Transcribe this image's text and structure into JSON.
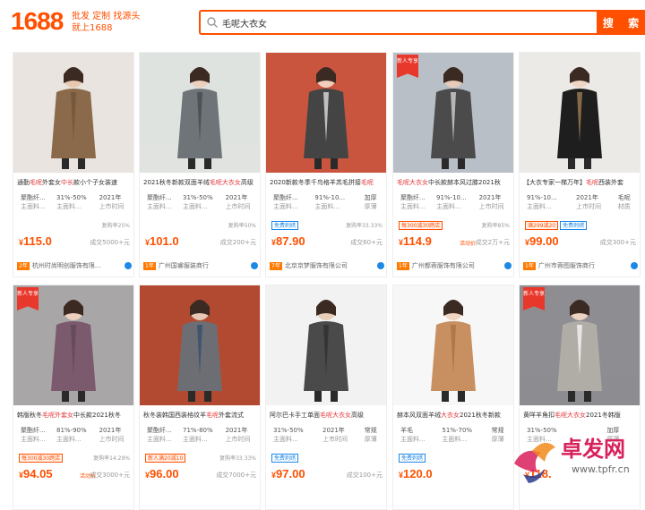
{
  "header": {
    "logo": "1688",
    "slogan_line1": "批发 定制 找源头",
    "slogan_line2": "就上1688",
    "search_value": "毛呢大衣女",
    "search_button": "搜 索"
  },
  "products": [
    {
      "title_pre": "通勤",
      "title_hl": "毛呢",
      "title_mid": "外套女",
      "title_hl2": "中长",
      "title_post": "款小个子女装速",
      "attrs": [
        [
          "聚酯纤...",
          "31%-50%",
          "2021年"
        ],
        [
          "主面料...",
          "主面料...",
          "上市时间"
        ]
      ],
      "badges": [],
      "rate": "复购率25%",
      "price": "115.0",
      "promo": "",
      "sales": "成交5000+元",
      "year": "2年",
      "shop": "杭州时尚明创服饰有限...",
      "new_tag": false
    },
    {
      "title_pre": "2021秋冬新款双面羊绒",
      "title_hl": "毛呢大衣女",
      "title_mid": "",
      "title_hl2": "",
      "title_post": "高级",
      "attrs": [
        [
          "聚酯纤...",
          "31%-50%",
          "2021年"
        ],
        [
          "主面料...",
          "主面料...",
          "上市时间"
        ]
      ],
      "badges": [],
      "rate": "复购率50%",
      "price": "101.0",
      "promo": "",
      "sales": "成交200+元",
      "year": "1年",
      "shop": "广州国睿服装商行",
      "new_tag": false
    },
    {
      "title_pre": "2020新款冬季千鸟格羊羔毛拼接",
      "title_hl": "毛呢",
      "title_mid": "",
      "title_hl2": "",
      "title_post": "",
      "attrs": [
        [
          "聚酯纤...",
          "91%-10...",
          "加厚"
        ],
        [
          "主面料...",
          "主面料...",
          "厚薄"
        ]
      ],
      "badges": [
        [
          "免费刺绣",
          "blue"
        ]
      ],
      "rate": "复购率33.33%",
      "price": "87.90",
      "promo": "",
      "sales": "成交60+元",
      "year": "7年",
      "shop": "北京京梦服饰有限公司",
      "new_tag": false
    },
    {
      "title_pre": "",
      "title_hl": "毛呢大衣女",
      "title_mid": "中长款赫本风过膝2021秋",
      "title_hl2": "",
      "title_post": "",
      "attrs": [
        [
          "聚酯纤...",
          "91%-10...",
          "2021年"
        ],
        [
          "主面料...",
          "主面料...",
          "上市时间"
        ]
      ],
      "badges": [
        [
          "每300减30跨店",
          "orange"
        ]
      ],
      "rate": "复购率85%",
      "price": "114.9",
      "promo": "活动价",
      "sales": "成交2万+元",
      "year": "1年",
      "shop": "广州都蓉服饰有限公司",
      "new_tag": true
    },
    {
      "title_pre": "【大衣专家一梯万年】",
      "title_hl": "毛呢",
      "title_mid": "西装外套",
      "title_hl2": "",
      "title_post": "",
      "attrs": [
        [
          "91%-10...",
          "2021年",
          "毛呢"
        ],
        [
          "主面料...",
          "上市时间",
          "材质"
        ]
      ],
      "badges": [
        [
          "满299减20",
          "orange"
        ],
        [
          "免费刺绣",
          "blue"
        ]
      ],
      "rate": "",
      "price": "99.00",
      "promo": "",
      "sales": "成交300+元",
      "year": "1年",
      "shop": "广州市蓉图服饰商行",
      "new_tag": false
    },
    {
      "title_pre": "韩版秋冬",
      "title_hl": "毛呢外套女",
      "title_mid": "中长款2021秋冬",
      "title_hl2": "",
      "title_post": "",
      "attrs": [
        [
          "聚酯纤...",
          "81%-90%",
          "2021年"
        ],
        [
          "主面料...",
          "主面料...",
          "上市时间"
        ]
      ],
      "badges": [
        [
          "每300减30跨店",
          "orange"
        ]
      ],
      "rate": "复购率14.29%",
      "price": "94.05",
      "promo": "活动价",
      "sales": "成交3000+元",
      "year": "",
      "shop": "",
      "new_tag": true
    },
    {
      "title_pre": "秋冬装韩国西装格纹羊",
      "title_hl": "毛呢",
      "title_mid": "外套流式",
      "title_hl2": "",
      "title_post": "",
      "attrs": [
        [
          "聚酯纤...",
          "71%-80%",
          "2021年"
        ],
        [
          "主面料...",
          "主面料...",
          "上市时间"
        ]
      ],
      "badges": [
        [
          "新人满20减10",
          "orange"
        ]
      ],
      "rate": "复购率33.33%",
      "price": "96.00",
      "promo": "",
      "sales": "成交7000+元",
      "year": "",
      "shop": "",
      "new_tag": false
    },
    {
      "title_pre": "阿尔巴卡手工单面",
      "title_hl": "毛呢大衣女",
      "title_mid": "高级",
      "title_hl2": "",
      "title_post": "",
      "attrs": [
        [
          "31%-50%",
          "2021年",
          "常规"
        ],
        [
          "主面料...",
          "上市时间",
          "厚薄"
        ]
      ],
      "badges": [
        [
          "免费刺绣",
          "blue"
        ]
      ],
      "rate": "",
      "price": "97.00",
      "promo": "",
      "sales": "成交100+元",
      "year": "",
      "shop": "",
      "new_tag": false
    },
    {
      "title_pre": "赫本风双面羊绒",
      "title_hl": "大衣女",
      "title_mid": "2021秋冬新款",
      "title_hl2": "",
      "title_post": "",
      "attrs": [
        [
          "羊毛",
          "51%-70%",
          "常规"
        ],
        [
          "主面料...",
          "主面料...",
          "厚薄"
        ]
      ],
      "badges": [
        [
          "免费刺绣",
          "blue"
        ]
      ],
      "rate": "",
      "price": "120.0",
      "promo": "",
      "sales": "",
      "year": "",
      "shop": "",
      "new_tag": false
    },
    {
      "title_pre": "黄咩羊角扣",
      "title_hl": "毛呢大衣女",
      "title_mid": "2021冬韩版",
      "title_hl2": "",
      "title_post": "",
      "attrs": [
        [
          "31%-50%",
          "",
          "加厚"
        ],
        [
          "主面料...",
          "",
          "厚薄"
        ]
      ],
      "badges": [],
      "rate": "",
      "price": "118.",
      "promo": "",
      "sales": "",
      "year": "",
      "shop": "",
      "new_tag": true
    }
  ],
  "new_tag_text": "新人专享",
  "watermark": {
    "brand": "卓发网",
    "url": "www.tpfr.cn"
  }
}
